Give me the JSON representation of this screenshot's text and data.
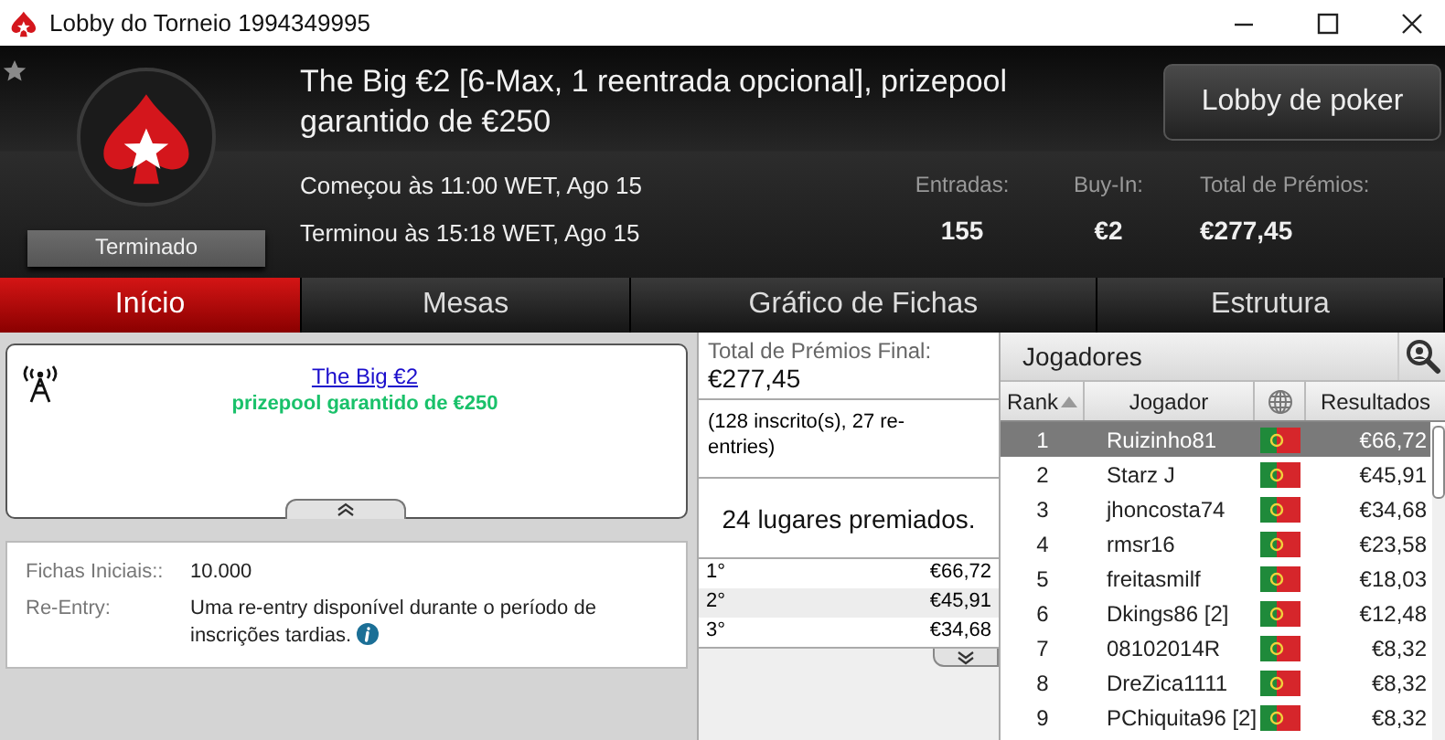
{
  "window": {
    "title": "Lobby do Torneio 1994349995"
  },
  "header": {
    "title": "The Big €2 [6-Max, 1 reentrada opcional], prizepool garantido de €250",
    "status": "Terminado",
    "started": "Começou às 11:00 WET, Ago 15",
    "ended": "Terminou às 15:18 WET, Ago 15",
    "lobby_button": "Lobby de poker",
    "stats": [
      {
        "label": "Entradas:",
        "value": "155"
      },
      {
        "label": "Buy-In:",
        "value": "€2"
      },
      {
        "label": "Total de Prémios:",
        "value": "€277,45"
      }
    ]
  },
  "tabs": [
    {
      "label": "Início",
      "selected": true
    },
    {
      "label": "Mesas",
      "selected": false
    },
    {
      "label": "Gráfico de Fichas",
      "selected": false
    },
    {
      "label": "Estrutura",
      "selected": false
    }
  ],
  "banner": {
    "link": "The Big €2",
    "subtitle": "prizepool garantido de €250"
  },
  "details": [
    {
      "label": "Fichas Iniciais::",
      "value": "10.000",
      "info": false
    },
    {
      "label": "Re-Entry:",
      "value": "Uma re-entry disponível durante o período de inscrições tardias.",
      "info": true
    }
  ],
  "prizes": {
    "total_label": "Total de Prémios Final:",
    "total": "€277,45",
    "entrants": "(128 inscrito(s), 27 re-entries)",
    "places": "24 lugares premiados.",
    "rows": [
      {
        "place": "1°",
        "amount": "€66,72"
      },
      {
        "place": "2°",
        "amount": "€45,91"
      },
      {
        "place": "3°",
        "amount": "€34,68"
      }
    ]
  },
  "players": {
    "title": "Jogadores",
    "columns": [
      "Rank",
      "Jogador",
      "Resultados"
    ],
    "rows": [
      {
        "rank": "1",
        "name": "Ruizinho81",
        "result": "€66,72",
        "selected": true
      },
      {
        "rank": "2",
        "name": "Starz J",
        "result": "€45,91",
        "selected": false
      },
      {
        "rank": "3",
        "name": "jhoncosta74",
        "result": "€34,68",
        "selected": false
      },
      {
        "rank": "4",
        "name": "rmsr16",
        "result": "€23,58",
        "selected": false
      },
      {
        "rank": "5",
        "name": "freitasmilf",
        "result": "€18,03",
        "selected": false
      },
      {
        "rank": "6",
        "name": "Dkings86 [2]",
        "result": "€12,48",
        "selected": false
      },
      {
        "rank": "7",
        "name": "08102014R",
        "result": "€8,32",
        "selected": false
      },
      {
        "rank": "8",
        "name": "DreZica1111",
        "result": "€8,32",
        "selected": false
      },
      {
        "rank": "9",
        "name": "PChiquita96 [2]",
        "result": "€8,32",
        "selected": false
      }
    ]
  }
}
